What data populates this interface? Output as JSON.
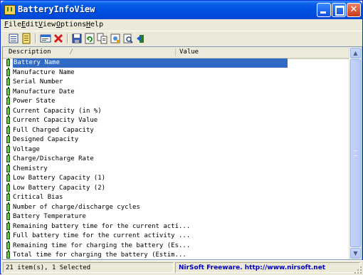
{
  "window": {
    "title": "BatteryInfoView"
  },
  "menu": [
    {
      "label": "File",
      "key": "F",
      "rest": "ile"
    },
    {
      "label": "Edit",
      "key": "E",
      "rest": "dit"
    },
    {
      "label": "View",
      "key": "V",
      "rest": "iew"
    },
    {
      "label": "Options",
      "key": "O",
      "rest": "ptions"
    },
    {
      "label": "Help",
      "key": "H",
      "rest": "elp"
    }
  ],
  "toolbar": {
    "icons": [
      "battery-info-icon",
      "log-icon",
      "properties-icon",
      "delete-icon",
      "save-icon",
      "refresh-icon",
      "copy-icon",
      "html-report-icon",
      "find-icon",
      "exit-icon"
    ]
  },
  "list": {
    "columns": [
      "Description",
      "Value"
    ],
    "sort_indicator": "/",
    "rows": [
      "Battery Name",
      "Manufacture Name",
      "Serial Number",
      "Manufacture Date",
      "Power State",
      "Current Capacity (in %)",
      "Current Capacity Value",
      "Full Charged Capacity",
      "Designed Capacity",
      "Voltage",
      "Charge/Discharge Rate",
      "Chemistry",
      "Low Battery Capacity (1)",
      "Low Battery Capacity (2)",
      "Critical Bias",
      "Number of charge/discharge cycles",
      "Battery Temperature",
      "Remaining battery time for the current acti...",
      "Full battery time for the current activity ...",
      "Remaining time for charging the battery (Es...",
      "Total  time for charging the battery (Estim..."
    ],
    "selected_index": 0
  },
  "status": {
    "items": "21 item(s), 1 Selected",
    "credit": "NirSoft Freeware.  http://www.nirsoft.net"
  },
  "colors": {
    "selection": "#316ac5",
    "titlebar": "#0050e0",
    "credit_link": "#0000c0"
  }
}
